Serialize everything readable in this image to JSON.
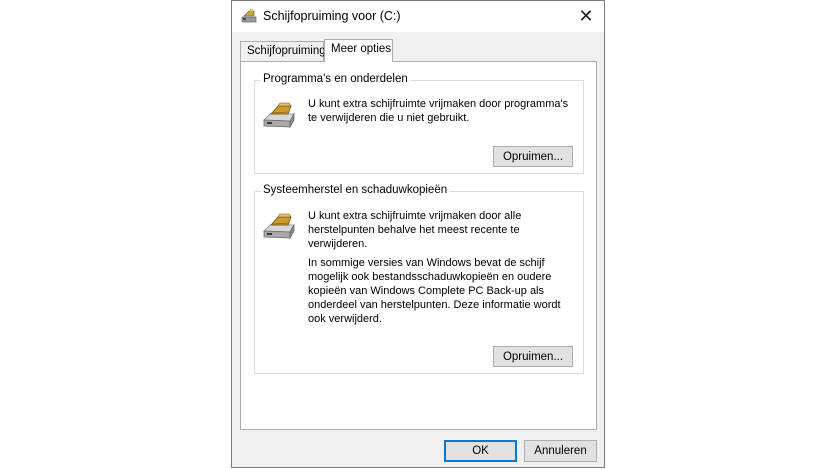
{
  "window": {
    "title": "Schijfopruiming voor  (C:)",
    "close_glyph": "✕"
  },
  "tabs": [
    {
      "label": "Schijfopruiming",
      "active": false
    },
    {
      "label": "Meer opties",
      "active": true
    }
  ],
  "groups": {
    "programs": {
      "title": "Programma's en onderdelen",
      "text": "U kunt extra schijfruimte vrijmaken door programma's te verwijderen die u niet gebruikt.",
      "button": "Opruimen...",
      "icon": "disk-cleanup-icon"
    },
    "restore": {
      "title": "Systeemherstel en schaduwkopieën",
      "text": "U kunt extra schijfruimte vrijmaken door alle herstelpunten behalve het meest recente te verwijderen.",
      "text2": "In sommige versies van Windows bevat de schijf mogelijk ook bestandsschaduwkopieën en oudere kopieën van Windows Complete PC Back-up als onderdeel van herstelpunten. Deze informatie wordt ook verwijderd.",
      "button": "Opruimen...",
      "icon": "disk-cleanup-icon"
    }
  },
  "footer": {
    "ok": "OK",
    "cancel": "Annuleren"
  },
  "colors": {
    "accent": "#0078d7",
    "dialog_bg": "#f0f0f0",
    "button_bg": "#e1e1e1"
  }
}
